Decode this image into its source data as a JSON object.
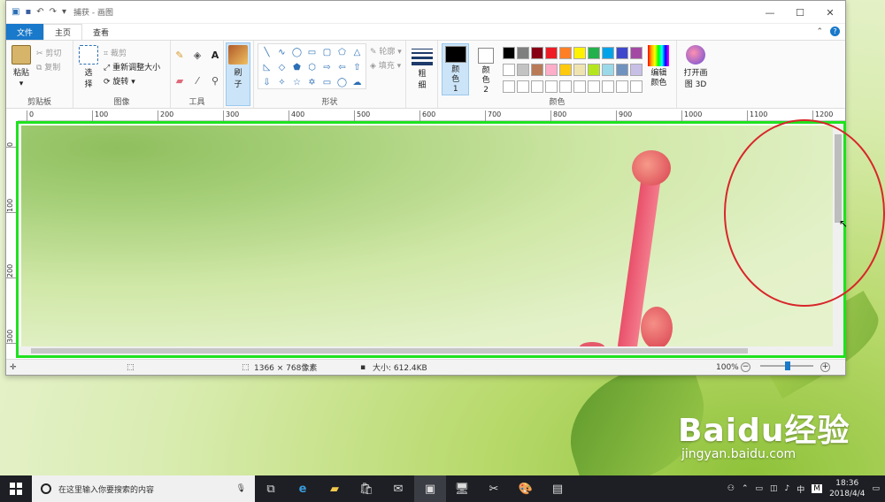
{
  "window": {
    "title": "捕获 - 画图"
  },
  "tabs": [
    "文件",
    "主页",
    "查看"
  ],
  "ribbon": {
    "clipboard": {
      "paste": "粘贴",
      "cut": "剪切",
      "copy": "复制",
      "label": "剪贴板"
    },
    "image": {
      "select": "选择",
      "crop": "裁剪",
      "resize": "重新调整大小",
      "rotate": "旋转",
      "label": "图像"
    },
    "tools": {
      "label": "工具",
      "text_tool": "A"
    },
    "brush": {
      "label": "刷子"
    },
    "shapes": {
      "outline": "轮廓",
      "fill": "填充",
      "label": "形状"
    },
    "size": {
      "label": "粗细"
    },
    "colors": {
      "color1": "颜色 1",
      "color2": "颜色 2",
      "edit": "编辑颜色",
      "label": "颜色",
      "palette": [
        "#000000",
        "#7f7f7f",
        "#880015",
        "#ed1c24",
        "#ff7f27",
        "#fff200",
        "#22b14c",
        "#00a2e8",
        "#3f48cc",
        "#a349a4",
        "#ffffff",
        "#c3c3c3",
        "#b97a57",
        "#ffaec9",
        "#ffc90e",
        "#efe4b0",
        "#b5e61d",
        "#99d9ea",
        "#7092be",
        "#c8bfe7",
        "#ffffff",
        "#ffffff",
        "#ffffff",
        "#ffffff",
        "#ffffff",
        "#ffffff",
        "#ffffff",
        "#ffffff",
        "#ffffff",
        "#ffffff"
      ]
    },
    "paint3d": {
      "label": "打开画图 3D"
    }
  },
  "ruler": {
    "h": [
      "0",
      "100",
      "200",
      "300",
      "400",
      "500",
      "600",
      "700",
      "800",
      "900",
      "1000",
      "1100",
      "1200"
    ],
    "v": [
      "0",
      "100",
      "200",
      "300"
    ]
  },
  "status": {
    "dimensions": "1366 × 768像素",
    "size": "大小: 612.4KB",
    "zoom": "100%"
  },
  "taskbar": {
    "search_placeholder": "在这里输入你要搜索的内容",
    "time": "18:36",
    "date": "2018/4/4",
    "ime": "中",
    "ime2": "M"
  },
  "watermark": {
    "brand": "Baidu经验",
    "url": "jingyan.baidu.com"
  }
}
